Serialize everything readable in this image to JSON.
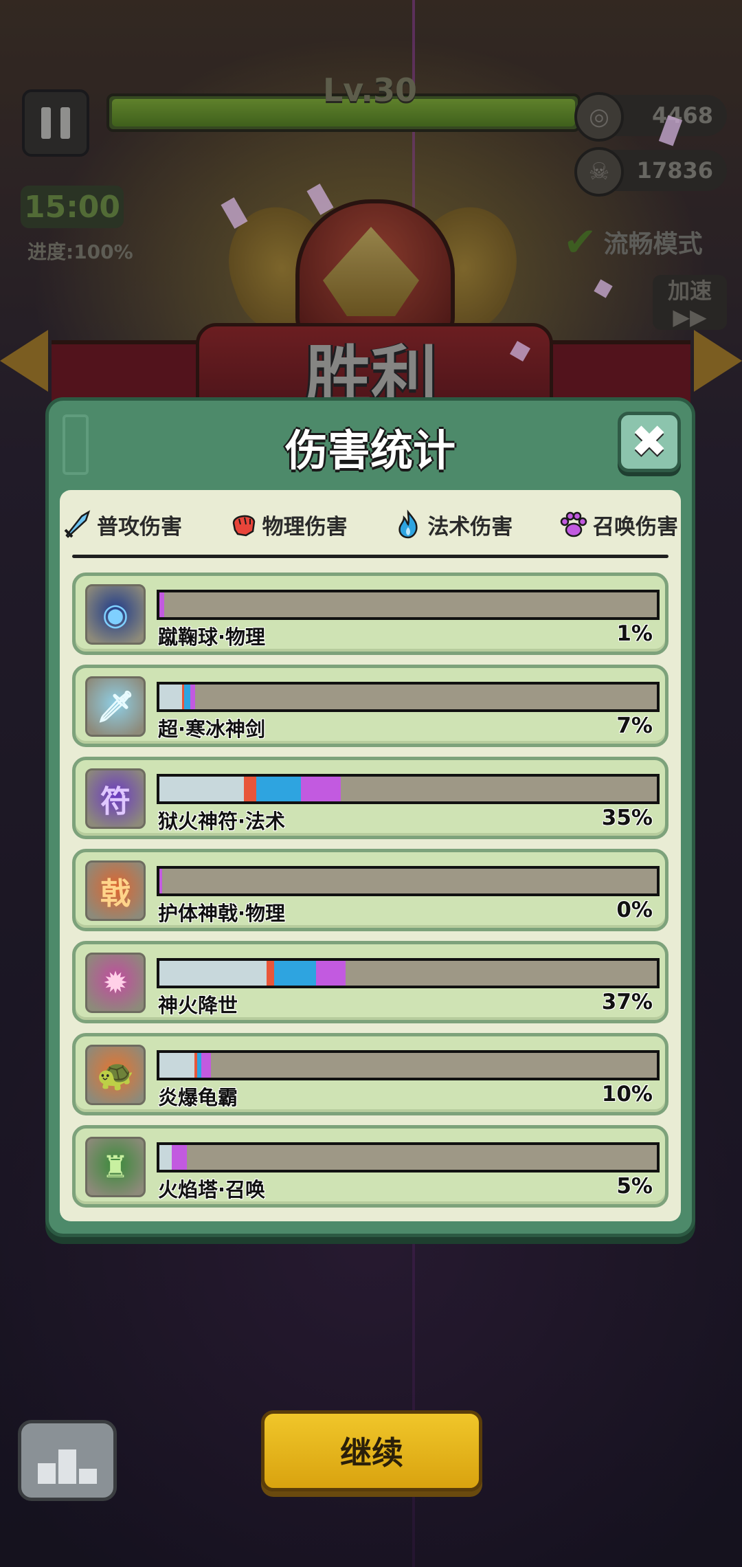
{
  "hud": {
    "level": "Lv.30",
    "coins": "4468",
    "kills": "17836",
    "timer": "15:00",
    "progress": "进度:100%",
    "smooth_mode": "流畅模式",
    "speed_label": "加速",
    "speed_arrows": "▶▶"
  },
  "victory_title": "胜利",
  "panel": {
    "title": "伤害统计",
    "close": "✖"
  },
  "legend": [
    {
      "label": "普攻伤害",
      "icon": "sword-icon",
      "color": "#4aa8e8"
    },
    {
      "label": "物理伤害",
      "icon": "fist-icon",
      "color": "#e8563a"
    },
    {
      "label": "法术伤害",
      "icon": "fire-icon",
      "color": "#2ea4e0"
    },
    {
      "label": "召唤伤害",
      "icon": "paw-icon",
      "color": "#c25ae0"
    }
  ],
  "colors": {
    "normal": "#c8d8dc",
    "physical": "#e8563a",
    "magic": "#2ea4e0",
    "summon": "#c25ae0"
  },
  "skills": [
    {
      "name": "蹴鞠球·物理",
      "percent": "1%",
      "icon": "ball-icon",
      "segments": {
        "normal": 0,
        "physical": 0,
        "magic": 0,
        "summon": 1
      }
    },
    {
      "name": "超·寒冰神剑",
      "percent": "7%",
      "icon": "ice-sword-icon",
      "segments": {
        "normal": 4.5,
        "physical": 0.5,
        "magic": 1.2,
        "summon": 1
      }
    },
    {
      "name": "狱火神符·法术",
      "percent": "35%",
      "icon": "talisman-icon",
      "segments": {
        "normal": 17,
        "physical": 2.5,
        "magic": 9,
        "summon": 8
      }
    },
    {
      "name": "护体神戟·物理",
      "percent": "0%",
      "icon": "halberd-icon",
      "segments": {
        "normal": 0,
        "physical": 0,
        "magic": 0,
        "summon": 0.5
      }
    },
    {
      "name": "神火降世",
      "percent": "37%",
      "icon": "divine-fire-icon",
      "segments": {
        "normal": 21.5,
        "physical": 1.5,
        "magic": 8.5,
        "summon": 6
      }
    },
    {
      "name": "炎爆龟霸",
      "percent": "10%",
      "icon": "turtle-icon",
      "segments": {
        "normal": 7,
        "physical": 0.6,
        "magic": 0.8,
        "summon": 2
      }
    },
    {
      "name": "火焰塔·召唤",
      "percent": "5%",
      "icon": "tower-icon",
      "segments": {
        "normal": 2.5,
        "physical": 0,
        "magic": 0,
        "summon": 3
      }
    }
  ],
  "continue_label": "继续"
}
